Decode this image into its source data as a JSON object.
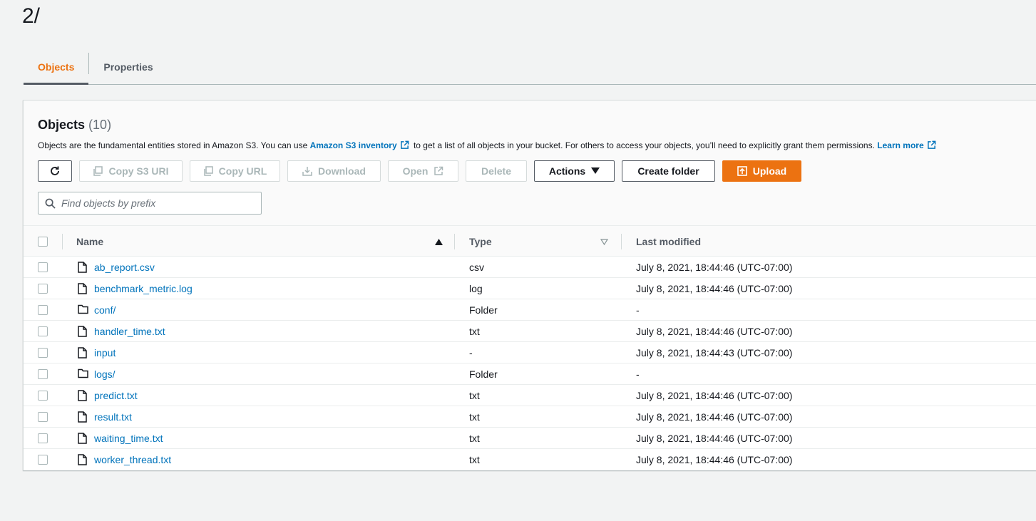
{
  "page": {
    "title": "2/"
  },
  "tabs": [
    {
      "label": "Objects",
      "active": true
    },
    {
      "label": "Properties",
      "active": false
    }
  ],
  "objects_panel": {
    "title": "Objects",
    "count": "(10)",
    "description": {
      "part1": "Objects are the fundamental entities stored in Amazon S3. You can use",
      "link1": "Amazon S3 inventory",
      "part2": "to get a list of all objects in your bucket. For others to access your objects, you’ll need to explicitly grant them permissions.",
      "link2": "Learn more"
    }
  },
  "toolbar": {
    "refresh_icon": "refresh-icon",
    "copy_s3_uri": "Copy S3 URI",
    "copy_url": "Copy URL",
    "download": "Download",
    "open": "Open",
    "delete": "Delete",
    "actions": "Actions",
    "create_folder": "Create folder",
    "upload": "Upload"
  },
  "search": {
    "placeholder": "Find objects by prefix",
    "value": ""
  },
  "table": {
    "columns": {
      "name": "Name",
      "type": "Type",
      "last_modified": "Last modified"
    },
    "sort": {
      "column": "Name",
      "direction": "ascending"
    },
    "rows": [
      {
        "name": "ab_report.csv",
        "kind": "file",
        "type": "csv",
        "last_modified": "July 8, 2021, 18:44:46 (UTC-07:00)"
      },
      {
        "name": "benchmark_metric.log",
        "kind": "file",
        "type": "log",
        "last_modified": "July 8, 2021, 18:44:46 (UTC-07:00)"
      },
      {
        "name": "conf/",
        "kind": "folder",
        "type": "Folder",
        "last_modified": "-"
      },
      {
        "name": "handler_time.txt",
        "kind": "file",
        "type": "txt",
        "last_modified": "July 8, 2021, 18:44:46 (UTC-07:00)"
      },
      {
        "name": "input",
        "kind": "file",
        "type": "-",
        "last_modified": "July 8, 2021, 18:44:43 (UTC-07:00)"
      },
      {
        "name": "logs/",
        "kind": "folder",
        "type": "Folder",
        "last_modified": "-"
      },
      {
        "name": "predict.txt",
        "kind": "file",
        "type": "txt",
        "last_modified": "July 8, 2021, 18:44:46 (UTC-07:00)"
      },
      {
        "name": "result.txt",
        "kind": "file",
        "type": "txt",
        "last_modified": "July 8, 2021, 18:44:46 (UTC-07:00)"
      },
      {
        "name": "waiting_time.txt",
        "kind": "file",
        "type": "txt",
        "last_modified": "July 8, 2021, 18:44:46 (UTC-07:00)"
      },
      {
        "name": "worker_thread.txt",
        "kind": "file",
        "type": "txt",
        "last_modified": "July 8, 2021, 18:44:46 (UTC-07:00)"
      }
    ]
  },
  "colors": {
    "accent": "#ec7211",
    "link": "#0073bb",
    "text": "#16191f",
    "muted": "#545b64"
  }
}
